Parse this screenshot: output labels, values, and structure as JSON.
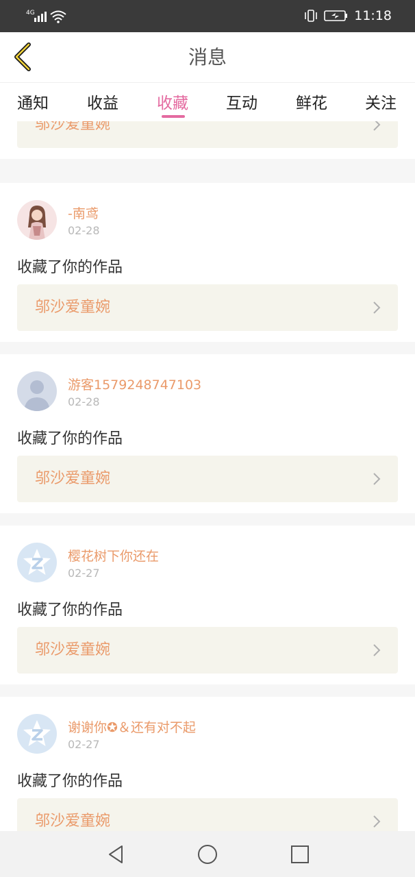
{
  "status_bar": {
    "network": "4G",
    "time": "11:18",
    "icons": [
      "signal-icon",
      "wifi-icon",
      "vibrate-icon",
      "battery-icon"
    ]
  },
  "header": {
    "title": "消息",
    "back_icon": "back-chevron-icon"
  },
  "tabs": [
    {
      "label": "通知",
      "active": false
    },
    {
      "label": "收益",
      "active": false
    },
    {
      "label": "收藏",
      "active": true
    },
    {
      "label": "互动",
      "active": false
    },
    {
      "label": "鲜花",
      "active": false
    },
    {
      "label": "关注",
      "active": false
    }
  ],
  "top_partial_card": {
    "work_title": "邬沙爱童婉"
  },
  "items": [
    {
      "username": "-南鸢",
      "date": "02-28",
      "action": "收藏了你的作品",
      "work_title": "邬沙爱童婉",
      "avatar": "anime-girl-avatar"
    },
    {
      "username": "游客1579248747103",
      "date": "02-28",
      "action": "收藏了你的作品",
      "work_title": "邬沙爱童婉",
      "avatar": "default-person-avatar"
    },
    {
      "username": "樱花树下你还在",
      "date": "02-27",
      "action": "收藏了你的作品",
      "work_title": "邬沙爱童婉",
      "avatar": "z-logo-avatar"
    },
    {
      "username": "谢谢你✪＆还有对不起",
      "date": "02-27",
      "action": "收藏了你的作品",
      "work_title": "邬沙爱童婉",
      "avatar": "z-logo-avatar"
    }
  ],
  "colors": {
    "accent": "#e46aa0",
    "username": "#ea9a6a",
    "work_bg": "#f5f4ec",
    "separator": "#f6f6f6"
  },
  "nav_bar": {
    "buttons": [
      "back-triangle-icon",
      "home-circle-icon",
      "recent-square-icon"
    ]
  }
}
